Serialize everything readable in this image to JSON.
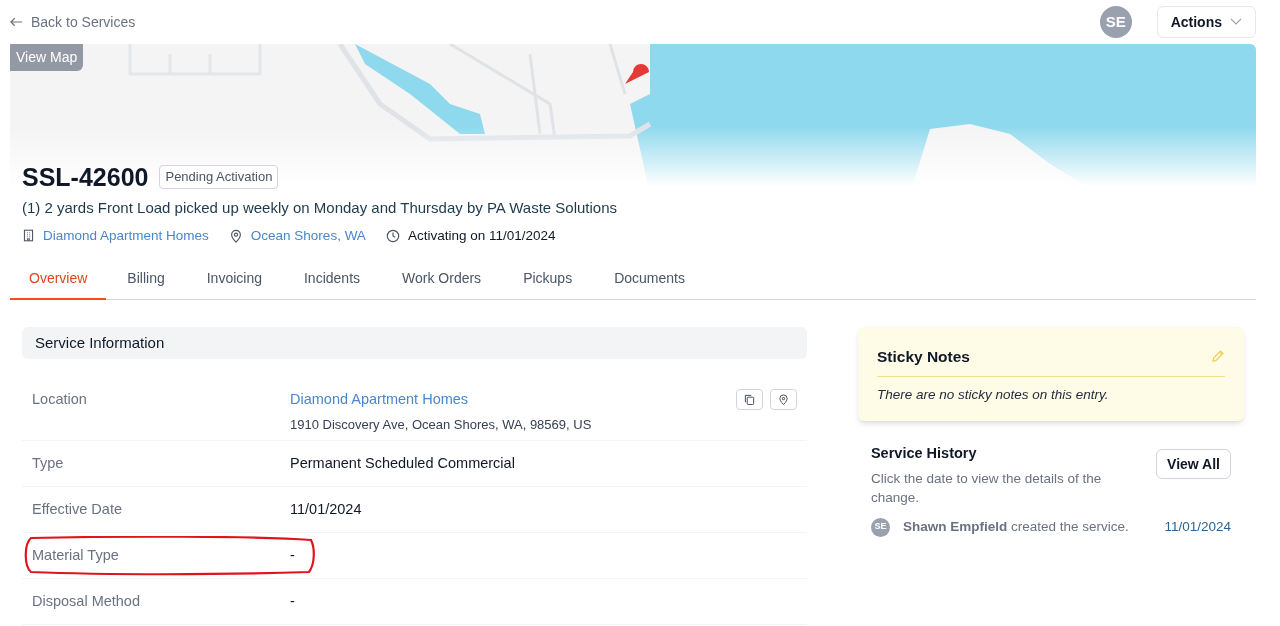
{
  "back_link": {
    "label": "Back to Services"
  },
  "user": {
    "initials": "SE"
  },
  "actions_button": {
    "label": "Actions"
  },
  "map": {
    "kind": "picture",
    "button": "View Map"
  },
  "service": {
    "id": "SSL-42600",
    "status": "Pending Activation",
    "description": "(1) 2 yards Front Load picked up weekly on Monday and Thursday by PA Waste Solutions",
    "meta": [
      {
        "kind": "building",
        "text": "Diamond Apartment Homes",
        "link": true
      },
      {
        "kind": "pin",
        "text": "Ocean Shores, WA",
        "link": true
      },
      {
        "kind": "clock",
        "text": "Activating on 11/01/2024",
        "link": false
      }
    ]
  },
  "tabs": [
    {
      "label": "Overview",
      "selected": true
    },
    {
      "label": "Billing",
      "selected": false
    },
    {
      "label": "Invoicing",
      "selected": false
    },
    {
      "label": "Incidents",
      "selected": false
    },
    {
      "label": "Work Orders",
      "selected": false
    },
    {
      "label": "Pickups",
      "selected": false
    },
    {
      "label": "Documents",
      "selected": false
    }
  ],
  "service_information": {
    "title": "Service Information",
    "rows": [
      {
        "label": "Location",
        "value": "Diamond Apartment Homes",
        "link": true,
        "address": "1910 Discovery Ave, Ocean Shores, WA, 98569, US",
        "highlighted": false
      },
      {
        "label": "Type",
        "value": "Permanent Scheduled Commercial",
        "link": false,
        "highlighted": false
      },
      {
        "label": "Effective Date",
        "value": "11/01/2024",
        "link": false,
        "highlighted": false
      },
      {
        "label": "Material Type",
        "value": "-",
        "link": false,
        "highlighted": true
      },
      {
        "label": "Disposal Method",
        "value": "-",
        "link": false,
        "highlighted": false
      }
    ]
  },
  "sticky_notes": {
    "title": "Sticky Notes",
    "empty_text": "There are no sticky notes on this entry."
  },
  "service_history": {
    "title": "Service History",
    "hint": "Click the date to view the details of the change.",
    "button": "View All",
    "entries": [
      {
        "initials": "SE",
        "text": "**Shawn Empfield** created the service.",
        "date": "11/01/2024"
      }
    ]
  }
}
